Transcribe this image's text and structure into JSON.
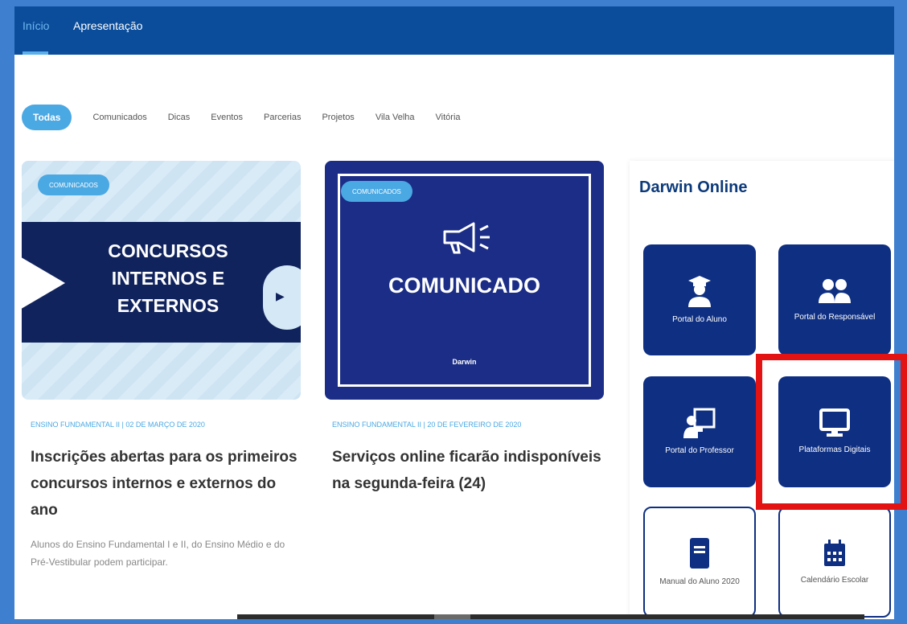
{
  "nav": {
    "tabs": [
      "Início",
      "Apresentação"
    ]
  },
  "filters": {
    "active": "Todas",
    "items": [
      "Comunicados",
      "Dicas",
      "Eventos",
      "Parcerias",
      "Projetos",
      "Vila Velha",
      "Vitória"
    ]
  },
  "posts": [
    {
      "badge": "COMUNICADOS",
      "image_text": "CONCURSOS INTERNOS E EXTERNOS",
      "meta": "ENSINO FUNDAMENTAL II | 02 DE MARÇO DE 2020",
      "title": "Inscrições abertas para os primeiros concursos internos e externos do ano",
      "excerpt": "Alunos do Ensino Fundamental I e II, do Ensino Médio e do Pré-Vestibular podem participar."
    },
    {
      "badge": "COMUNICADOS",
      "image_text": "COMUNICADO",
      "logo": "Darwin",
      "meta": "ENSINO FUNDAMENTAL II | 20 DE FEVEREIRO DE 2020",
      "title": "Serviços online ficarão indisponíveis na segunda-feira (24)"
    }
  ],
  "sidebar": {
    "title": "Darwin Online",
    "tiles": [
      {
        "label": "Portal do Aluno",
        "icon": "graduate-icon"
      },
      {
        "label": "Portal do Responsável",
        "icon": "users-icon"
      },
      {
        "label": "Portal do Professor",
        "icon": "teacher-icon"
      },
      {
        "label": "Plataformas Digitais",
        "icon": "desktop-icon"
      },
      {
        "label": "Manual do Aluno 2020",
        "icon": "book-icon"
      },
      {
        "label": "Calendário Escolar",
        "icon": "calendar-icon"
      }
    ]
  },
  "colors": {
    "brand": "#0b4d9b",
    "accent": "#4aa8e3",
    "tile": "#0e2f82",
    "highlight": "#e41313"
  }
}
